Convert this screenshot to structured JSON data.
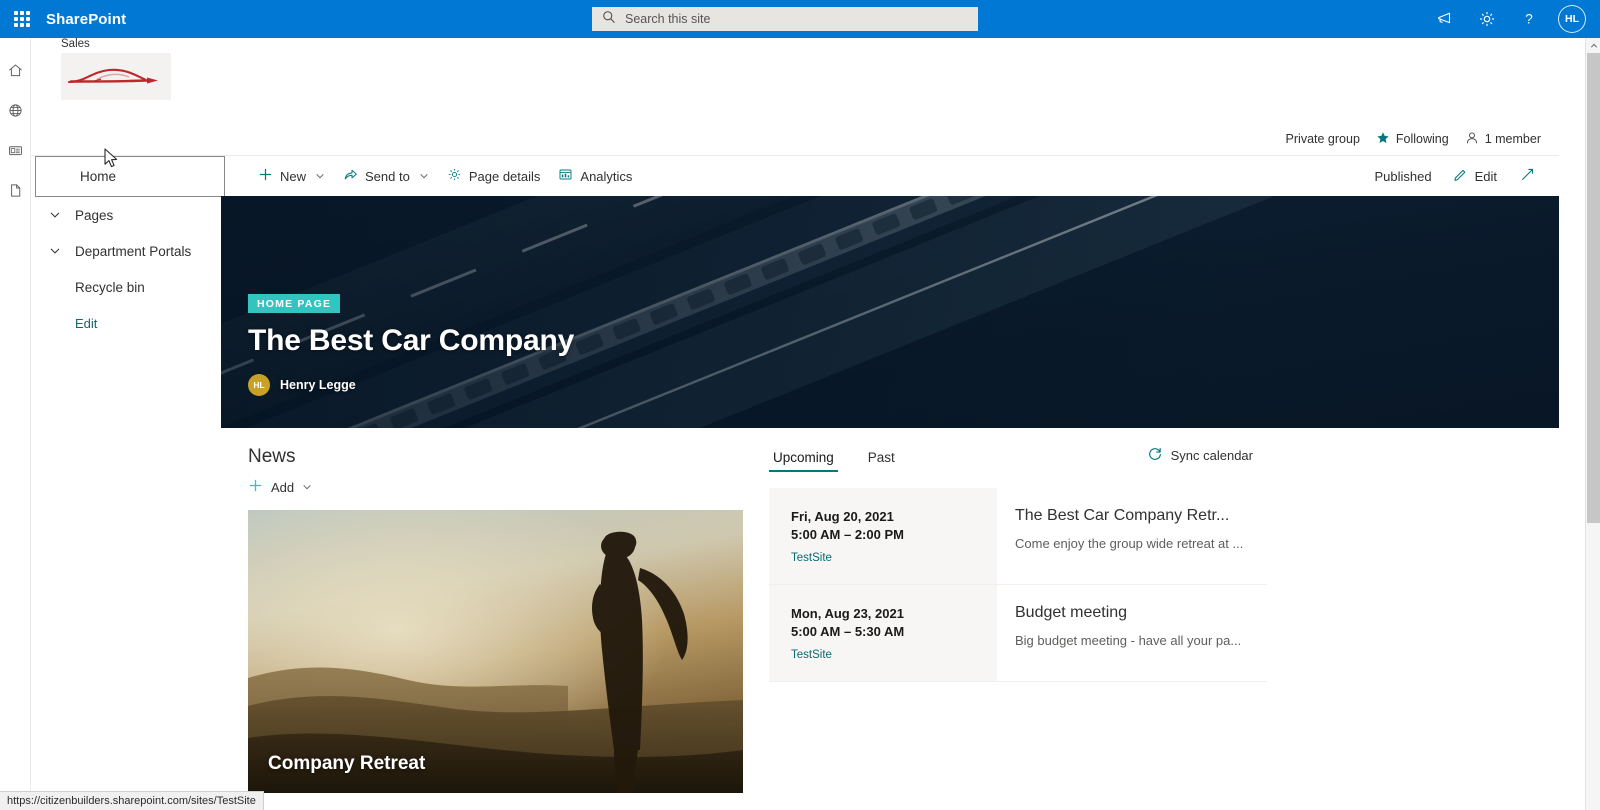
{
  "suite": {
    "brand": "SharePoint",
    "search_placeholder": "Search this site",
    "search_value": "",
    "waffle_name": "app-launcher",
    "icons": {
      "megaphone": "megaphone-icon",
      "settings": "gear-icon",
      "help": "help-icon"
    },
    "avatar_initials": "HL"
  },
  "rail": {
    "items": [
      {
        "name": "home-icon",
        "label": "Home"
      },
      {
        "name": "globe-icon",
        "label": "Sites"
      },
      {
        "name": "news-icon",
        "label": "News"
      },
      {
        "name": "document-icon",
        "label": "Files"
      }
    ]
  },
  "site": {
    "title": "Sales",
    "logo_alt": "car-logo",
    "privacy": "Private group",
    "following": "Following",
    "members": "1 member"
  },
  "commands": {
    "new": "New",
    "send_to": "Send to",
    "page_details": "Page details",
    "analytics": "Analytics",
    "published": "Published",
    "edit": "Edit",
    "expand": "expand-icon"
  },
  "nav": {
    "items": [
      {
        "label": "Home",
        "has_chevron": false,
        "focused": true,
        "style": "focused"
      },
      {
        "label": "Pages",
        "has_chevron": true,
        "focused": false,
        "style": "parent"
      },
      {
        "label": "Department Portals",
        "has_chevron": true,
        "focused": false,
        "style": "parent"
      },
      {
        "label": "Recycle bin",
        "has_chevron": false,
        "focused": false,
        "style": "indent"
      },
      {
        "label": "Edit",
        "has_chevron": false,
        "focused": false,
        "style": "edit"
      }
    ]
  },
  "hero": {
    "badge": "HOME PAGE",
    "title": "The Best Car Company",
    "author_initials": "HL",
    "author_name": "Henry Legge",
    "badge_color": "#32c4c0"
  },
  "news": {
    "heading": "News",
    "add_label": "Add",
    "cards": [
      {
        "caption": "Company Retreat"
      }
    ]
  },
  "events": {
    "tabs": [
      {
        "label": "Upcoming",
        "active": true
      },
      {
        "label": "Past",
        "active": false
      }
    ],
    "sync_label": "Sync calendar",
    "items": [
      {
        "date": "Fri, Aug 20, 2021",
        "time": "5:00 AM – 2:00 PM",
        "site": "TestSite",
        "title": "The Best Car Company Retr...",
        "desc": "Come enjoy the group wide retreat at ..."
      },
      {
        "date": "Mon, Aug 23, 2021",
        "time": "5:00 AM – 5:30 AM",
        "site": "TestSite",
        "title": "Budget meeting",
        "desc": "Big budget meeting - have all your pa..."
      }
    ]
  },
  "status": {
    "url": "https://citizenbuilders.sharepoint.com/sites/TestSite"
  },
  "colors": {
    "brand_blue": "#0078d4",
    "teal_accent": "#03787c",
    "badge_teal": "#32c4c0",
    "link_teal": "#0b6a6d"
  }
}
